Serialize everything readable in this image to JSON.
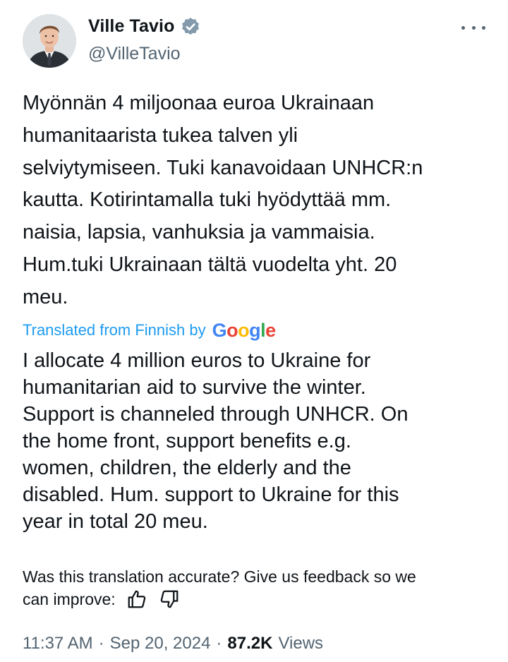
{
  "author": {
    "display_name": "Ville Tavio",
    "handle": "@VilleTavio",
    "verified": true
  },
  "menu": {
    "icon": "more-horizontal-icon"
  },
  "tweet": {
    "original_text": "Myönnän 4 miljoonaa euroa Ukrainaan\nhumanitaarista tukea talven yli\nselviytymiseen. Tuki kanavoidaan UNHCR:n\nkautta. Kotirintamalla tuki hyödyttää mm.\nnaisia, lapsia, vanhuksia ja vammaisia.\nHum.tuki Ukrainaan tältä vuodelta yht. 20\nmeu.",
    "translated_label": "Translated from Finnish by",
    "translator_brand": "Google",
    "translated_text": "I allocate 4 million euros to Ukraine for\nhumanitarian aid to survive the winter.\nSupport is channeled through UNHCR. On\nthe home front, support benefits e.g.\nwomen, children, the elderly and the\ndisabled. Hum. support to Ukraine for this\nyear in total 20 meu."
  },
  "feedback": {
    "line1": "Was this translation accurate? Give us feedback so we",
    "line2": "can improve:",
    "thumbs_up_icon": "thumbs-up-icon",
    "thumbs_down_icon": "thumbs-down-icon"
  },
  "meta": {
    "time": "11:37 AM",
    "separator": "·",
    "date": "Sep 20, 2024",
    "views_count": "87.2K",
    "views_label": "Views"
  },
  "colors": {
    "link_blue": "#1d9bf0",
    "secondary_text": "#536471",
    "primary_text": "#0f1419",
    "google_blue": "#4285F4",
    "google_red": "#EA4335",
    "google_yellow": "#FBBC05",
    "google_green": "#34A853"
  }
}
